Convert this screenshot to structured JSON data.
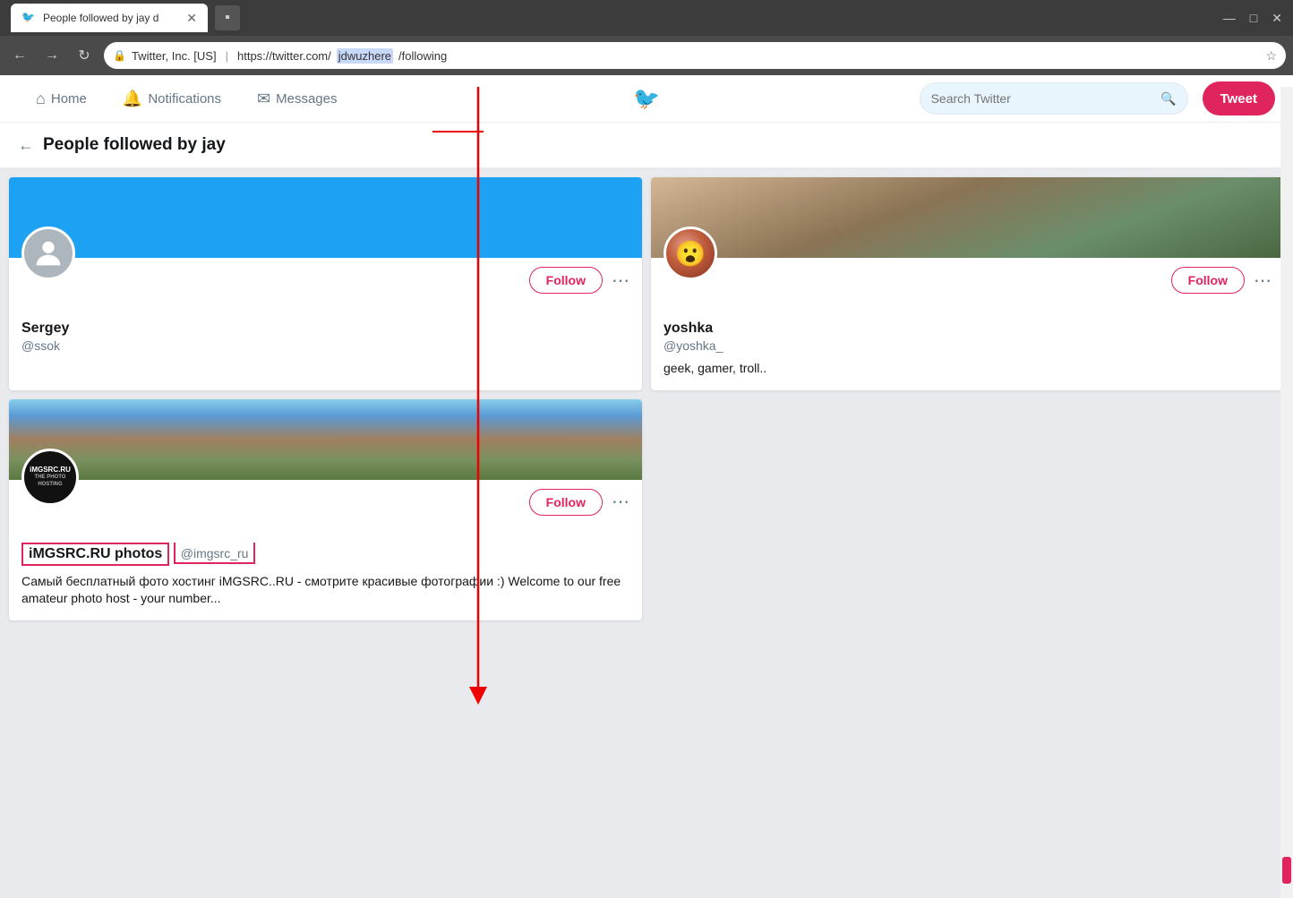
{
  "browser": {
    "tab_title": "People followed by jay d",
    "tab_favicon": "🐦",
    "address_org": "Twitter, Inc. [US]",
    "address_url": "https://twitter.com/",
    "address_highlight": "jdwuzhere",
    "address_path": "/following",
    "new_tab_label": "+",
    "window_controls": {
      "minimize": "—",
      "maximize": "□",
      "close": "✕"
    }
  },
  "nav": {
    "home_label": "Home",
    "notifications_label": "Notifications",
    "messages_label": "Messages",
    "search_placeholder": "Search Twitter",
    "tweet_button_label": "Tweet"
  },
  "page": {
    "title": "People followed by jay"
  },
  "users": [
    {
      "id": "sergey",
      "name": "Sergey",
      "handle": "@ssok",
      "bio": "",
      "follow_label": "Follow",
      "has_banner": true,
      "banner_type": "blue",
      "avatar_type": "gray-user"
    },
    {
      "id": "yoshka",
      "name": "yoshka",
      "handle": "@yoshka_",
      "bio": "geek, gamer, troll..",
      "follow_label": "Follow",
      "has_banner": true,
      "banner_type": "photo",
      "avatar_type": "photo"
    },
    {
      "id": "imgsrc",
      "name": "iMGSRC.RU photos",
      "handle": "@imgsrc_ru",
      "bio": "Самый бесплатный фото хостинг iMGSRC..RU - смотрите красивые фотографии :) Welcome to our free amateur photo host - your number...",
      "follow_label": "Follow",
      "has_banner": true,
      "banner_type": "mountain",
      "avatar_type": "imgsrc",
      "name_highlighted": true
    }
  ]
}
